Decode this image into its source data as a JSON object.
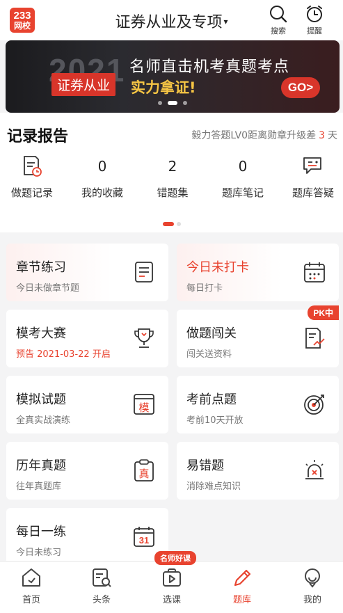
{
  "header": {
    "logo_top": "233",
    "logo_bottom": "网校",
    "title": "证券从业及专项",
    "caret": "▾",
    "search_label": "搜索",
    "remind_label": "提醒"
  },
  "banner": {
    "year": "2021",
    "tag": "证券从业",
    "headline": "名师直击机考真题考点",
    "subline": "实力拿证!",
    "go_label": "GO>"
  },
  "record": {
    "title": "记录报告",
    "note_prefix": "毅力答题LV0距离勋章升级差",
    "note_days": "3",
    "note_suffix": "天",
    "stats": [
      {
        "label": "做题记录",
        "icon": "document-clock-icon"
      },
      {
        "value": "0",
        "label": "我的收藏"
      },
      {
        "value": "2",
        "label": "错题集"
      },
      {
        "value": "0",
        "label": "题库笔记"
      },
      {
        "label": "题库答疑",
        "icon": "chat-bubble-icon"
      }
    ]
  },
  "cards": [
    {
      "title": "章节练习",
      "subtitle": "今日未做章节题",
      "icon": "list-document-icon"
    },
    {
      "title": "今日未打卡",
      "subtitle": "每日打卡",
      "icon": "calendar-icon"
    },
    {
      "title": "模考大赛",
      "subtitle": "预告 2021-03-22 开启",
      "icon": "trophy-icon"
    },
    {
      "title": "做题闯关",
      "subtitle": "闯关送资料",
      "icon": "chart-document-icon",
      "badge": "PK中"
    },
    {
      "title": "模拟试题",
      "subtitle": "全真实战演练",
      "icon": "mock-exam-icon",
      "icon_text": "模"
    },
    {
      "title": "考前点题",
      "subtitle": "考前10天开放",
      "icon": "target-icon"
    },
    {
      "title": "历年真题",
      "subtitle": "往年真题库",
      "icon": "clipboard-icon",
      "icon_text": "真"
    },
    {
      "title": "易错题",
      "subtitle": "消除难点知识",
      "icon": "alarm-light-icon"
    },
    {
      "title": "每日一练",
      "subtitle": "今日未练习",
      "icon": "daily-calendar-icon",
      "icon_text": "31"
    }
  ],
  "tabbar": {
    "badge": "名师好课",
    "items": [
      {
        "label": "首页",
        "icon": "home-icon"
      },
      {
        "label": "头条",
        "icon": "news-search-icon"
      },
      {
        "label": "选课",
        "icon": "play-bag-icon"
      },
      {
        "label": "题库",
        "icon": "pencil-icon",
        "active": true
      },
      {
        "label": "我的",
        "icon": "profile-icon"
      }
    ]
  },
  "colors": {
    "accent": "#e8432f",
    "banner_text_gold": "#f6c544"
  }
}
